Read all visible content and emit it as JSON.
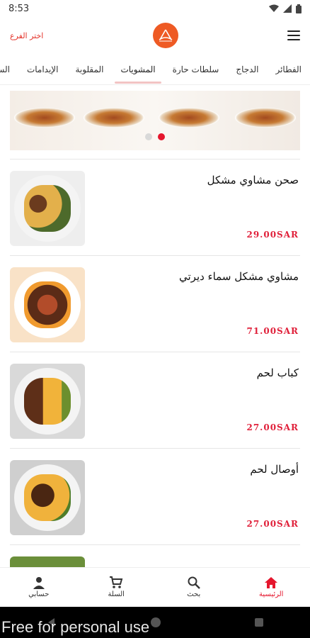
{
  "status_bar": {
    "time": "8:53"
  },
  "header": {
    "branch_label": "اختر الفرع"
  },
  "category_tabs": [
    {
      "label": "الفطائر"
    },
    {
      "label": "الدجاج"
    },
    {
      "label": "سلطات حارة"
    },
    {
      "label": "المشويات",
      "active": true
    },
    {
      "label": "المقلوبة"
    },
    {
      "label": "الإيدامات"
    },
    {
      "label": "السلطات"
    }
  ],
  "banner": {
    "active_slide": 2,
    "slide_count": 2
  },
  "menu_items": [
    {
      "name": "صحن مشاوي مشكل",
      "price": "29.00SAR",
      "palette": [
        "#6b3b1e",
        "#e3b04b",
        "#4d6a2b"
      ]
    },
    {
      "name": "مشاوي مشكل سماء ديرتي",
      "price": "71.00SAR",
      "palette": [
        "#5b2b17",
        "#b24c2a",
        "#f09a2e"
      ]
    },
    {
      "name": "كباب لحم",
      "price": "27.00SAR",
      "palette": [
        "#5e2f18",
        "#f1b33a",
        "#6c8f2e"
      ]
    },
    {
      "name": "أوصال لحم",
      "price": "27.00SAR",
      "palette": [
        "#4a2612",
        "#f0b23c",
        "#4f7d2a"
      ]
    }
  ],
  "bottom_nav": [
    {
      "label": "حسابي",
      "icon": "person-icon"
    },
    {
      "label": "السلة",
      "icon": "cart-icon"
    },
    {
      "label": "بحث",
      "icon": "search-icon"
    },
    {
      "label": "الرئيسية",
      "icon": "home-icon",
      "active": true
    }
  ],
  "watermark": "Free for personal use",
  "colors": {
    "accent": "#e5162d",
    "brand": "#ee5a24",
    "price": "#e0203a"
  }
}
